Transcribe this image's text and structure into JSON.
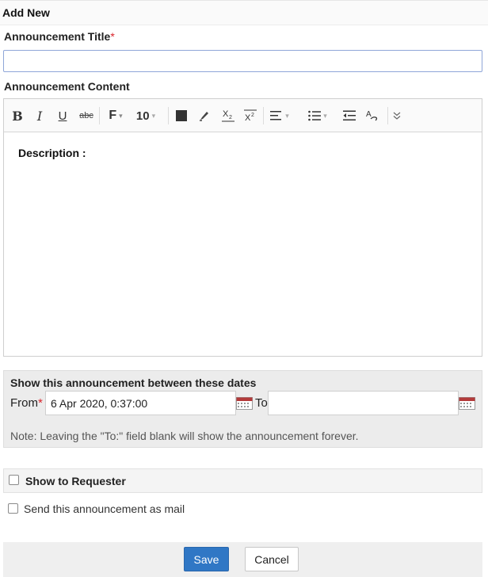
{
  "header": {
    "title": "Add New"
  },
  "form": {
    "title_label": "Announcement Title",
    "required_mark": "*",
    "title_value": "",
    "content_label": "Announcement Content"
  },
  "toolbar": {
    "items": [
      {
        "name": "bold-icon",
        "glyph": "B"
      },
      {
        "name": "italic-icon",
        "glyph": "I"
      },
      {
        "name": "underline-icon",
        "glyph": "U"
      },
      {
        "name": "strikethrough-icon",
        "glyph": "abc"
      },
      {
        "name": "font-family-icon",
        "glyph": "F"
      },
      {
        "name": "font-size-dropdown",
        "glyph": "10"
      },
      {
        "name": "font-color-icon"
      },
      {
        "name": "highlight-icon"
      },
      {
        "name": "subscript-icon",
        "glyph": "X2"
      },
      {
        "name": "superscript-icon",
        "glyph": "X2"
      },
      {
        "name": "align-icon"
      },
      {
        "name": "list-icon"
      },
      {
        "name": "outdent-icon"
      },
      {
        "name": "spellcheck-icon",
        "glyph": "A"
      },
      {
        "name": "more-icon"
      }
    ]
  },
  "editor": {
    "content": "Description :"
  },
  "dates": {
    "title": "Show this announcement between these dates",
    "from_label": "From",
    "from_value": "6 Apr 2020, 0:37:00",
    "to_label": "To",
    "to_value": "",
    "note": "Note: Leaving the \"To:\" field blank will show the announcement forever."
  },
  "options": {
    "show_requester_label": "Show to Requester",
    "show_requester_checked": false,
    "send_mail_label": "Send this announcement as mail",
    "send_mail_checked": false
  },
  "buttons": {
    "save": "Save",
    "cancel": "Cancel"
  },
  "colors": {
    "primary": "#3077c5",
    "required": "#d9242b",
    "calendar": "#b33a3a"
  }
}
